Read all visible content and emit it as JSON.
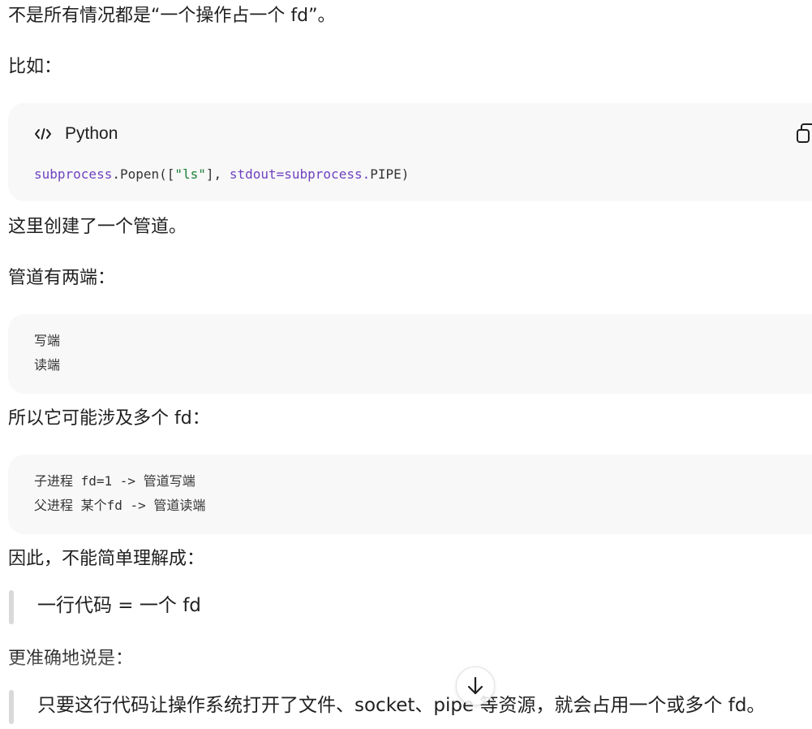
{
  "paragraphs": {
    "p1": "不是所有情况都是“一个操作占一个 fd”。",
    "p2": "比如：",
    "p3": "这里创建了一个管道。",
    "p4": "管道有两端：",
    "p5": "所以它可能涉及多个 fd：",
    "p6": "因此，不能简单理解成：",
    "p7": "更准确地说是："
  },
  "code_block_python": {
    "language": "Python",
    "lang_icon": "code-icon",
    "copy_icon": "copy-icon",
    "tokens": {
      "t1": "subprocess",
      "t2": ".Popen([",
      "t3": "\"ls\"",
      "t4": "], ",
      "t5": "stdout=subprocess.",
      "t6": "PIPE)"
    }
  },
  "code_block_pipe_ends": {
    "lines": [
      "写端",
      "读端"
    ]
  },
  "code_block_fds": {
    "lines": [
      "子进程 fd=1 -> 管道写端",
      "父进程 某个fd -> 管道读端"
    ]
  },
  "quotes": {
    "q1": "一行代码 = 一个 fd",
    "q2": "只要这行代码让操作系统打开了文件、socket、pipe 等资源，就会占用一个或多个 fd。"
  },
  "scroll_button": {
    "icon": "arrow-down-icon"
  },
  "colors": {
    "code_background": "#f8f8f8",
    "module_token": "#6f42c1",
    "string_token": "#1a7f37",
    "quote_bar": "#d9d9d9"
  }
}
